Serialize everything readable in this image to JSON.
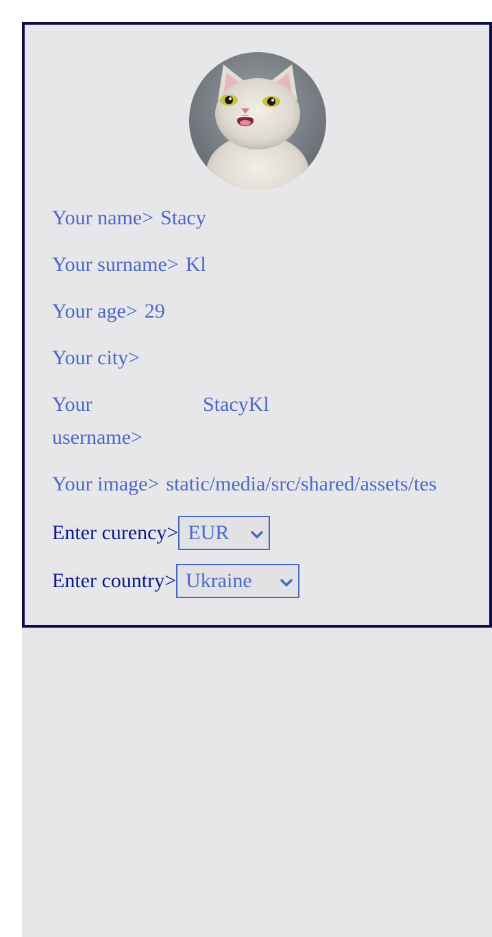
{
  "profile": {
    "fields": [
      {
        "label": "Your name>",
        "value": "Stacy"
      },
      {
        "label": "Your surname>",
        "value": "Kl"
      },
      {
        "label": "Your age>",
        "value": "29"
      },
      {
        "label": "Your city>",
        "value": ""
      },
      {
        "label": "Your username>",
        "value": "StacyKl"
      },
      {
        "label": "Your image>",
        "value": "static/media/src/shared/assets/tes"
      }
    ],
    "currency": {
      "label": "Enter curency>",
      "selected": "EUR"
    },
    "country": {
      "label": "Enter country>",
      "selected": "Ukraine"
    }
  },
  "colors": {
    "card_border": "#0d0b4a",
    "field_text": "#4a68c8",
    "select_label_text": "#0a1a8c",
    "background": "#e7e7ea"
  },
  "icons": {
    "select_arrow": "chevron-down-icon"
  }
}
